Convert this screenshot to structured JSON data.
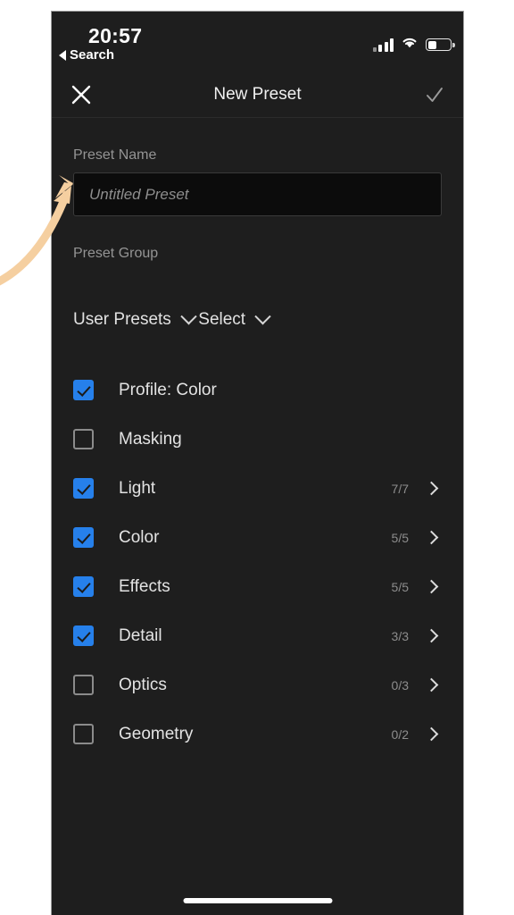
{
  "status_bar": {
    "time": "20:57",
    "back_label": "Search",
    "back_icon": "triangle-left-icon",
    "signal_icon": "cellular-signal-icon",
    "wifi_icon": "wifi-icon",
    "battery_icon": "battery-icon",
    "battery_level_percent": 35
  },
  "nav": {
    "close_icon": "close-icon",
    "title": "New Preset",
    "confirm_icon": "checkmark-icon"
  },
  "form": {
    "preset_name_label": "Preset Name",
    "preset_name_value": "",
    "preset_name_placeholder": "Untitled Preset",
    "preset_group_label": "Preset Group",
    "preset_group_value": "User Presets",
    "preset_group_chevron": "chevron-down-icon",
    "select_value": "Select",
    "select_chevron": "chevron-down-icon"
  },
  "settings_list": [
    {
      "label": "Profile: Color",
      "checked": true,
      "count": "",
      "has_chevron": false
    },
    {
      "label": "Masking",
      "checked": false,
      "count": "",
      "has_chevron": false
    },
    {
      "label": "Light",
      "checked": true,
      "count": "7/7",
      "has_chevron": true
    },
    {
      "label": "Color",
      "checked": true,
      "count": "5/5",
      "has_chevron": true
    },
    {
      "label": "Effects",
      "checked": true,
      "count": "5/5",
      "has_chevron": true
    },
    {
      "label": "Detail",
      "checked": true,
      "count": "3/3",
      "has_chevron": true
    },
    {
      "label": "Optics",
      "checked": false,
      "count": "0/3",
      "has_chevron": true
    },
    {
      "label": "Geometry",
      "checked": false,
      "count": "0/2",
      "has_chevron": true
    }
  ],
  "annotation": {
    "arrow_icon": "curved-arrow-pointing-right",
    "arrow_color": "#f5cfa0",
    "points_to": "preset-name-input"
  },
  "home_indicator": "home-indicator-bar",
  "colors": {
    "page_background": "#ffffff",
    "screen_background": "#1e1e1e",
    "input_background": "#0c0c0c",
    "accent_blue": "#2680eb",
    "primary_text": "#e3e3e3",
    "secondary_text": "#8d8d8d"
  }
}
